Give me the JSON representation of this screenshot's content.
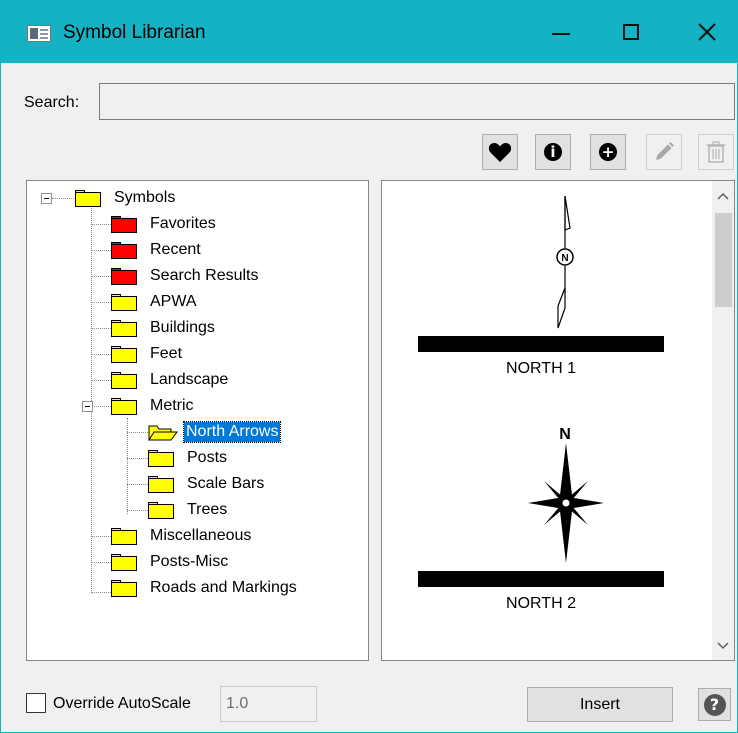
{
  "window": {
    "title": "Symbol Librarian",
    "minimize_icon": "minimize-icon",
    "maximize_icon": "maximize-icon",
    "close_icon": "close-icon"
  },
  "search": {
    "label": "Search:",
    "value": "",
    "placeholder": ""
  },
  "toolbar": {
    "favorite": {
      "icon": "heart-icon",
      "enabled": true
    },
    "info": {
      "icon": "info-icon",
      "glyph": "i",
      "enabled": true
    },
    "add": {
      "icon": "plus-icon",
      "glyph": "+",
      "enabled": true
    },
    "edit": {
      "icon": "pencil-icon",
      "enabled": false
    },
    "delete": {
      "icon": "trash-icon",
      "enabled": false
    }
  },
  "tree": {
    "root": {
      "label": "Symbols",
      "expanded": true
    },
    "items": [
      {
        "label": "Favorites",
        "color": "red"
      },
      {
        "label": "Recent",
        "color": "red"
      },
      {
        "label": "Search Results",
        "color": "red"
      },
      {
        "label": "APWA",
        "color": "yellow"
      },
      {
        "label": "Buildings",
        "color": "yellow"
      },
      {
        "label": "Feet",
        "color": "yellow"
      },
      {
        "label": "Landscape",
        "color": "yellow"
      },
      {
        "label": "Metric",
        "color": "yellow",
        "expanded": true
      },
      {
        "label": "North Arrows",
        "color": "yellow",
        "selected": true,
        "open": true
      },
      {
        "label": "Posts",
        "color": "yellow"
      },
      {
        "label": "Scale Bars",
        "color": "yellow"
      },
      {
        "label": "Trees",
        "color": "yellow"
      },
      {
        "label": "Miscellaneous",
        "color": "yellow"
      },
      {
        "label": "Posts-Misc",
        "color": "yellow"
      },
      {
        "label": "Roads and Markings",
        "color": "yellow"
      }
    ]
  },
  "preview": {
    "symbols": [
      {
        "name": "NORTH 1",
        "icon": "north-arrow-1-icon"
      },
      {
        "name": "NORTH 2",
        "icon": "north-arrow-2-icon"
      }
    ],
    "n_glyph": "N"
  },
  "footer": {
    "override_label": "Override AutoScale",
    "override_checked": false,
    "scale_value": "1.0",
    "insert_label": "Insert",
    "help_icon": "help-icon",
    "help_glyph": "?"
  },
  "colors": {
    "titlebar": "#13b3c3",
    "selection": "#0078d7",
    "folder_yellow": "#ffff00",
    "folder_red": "#ff0000"
  }
}
